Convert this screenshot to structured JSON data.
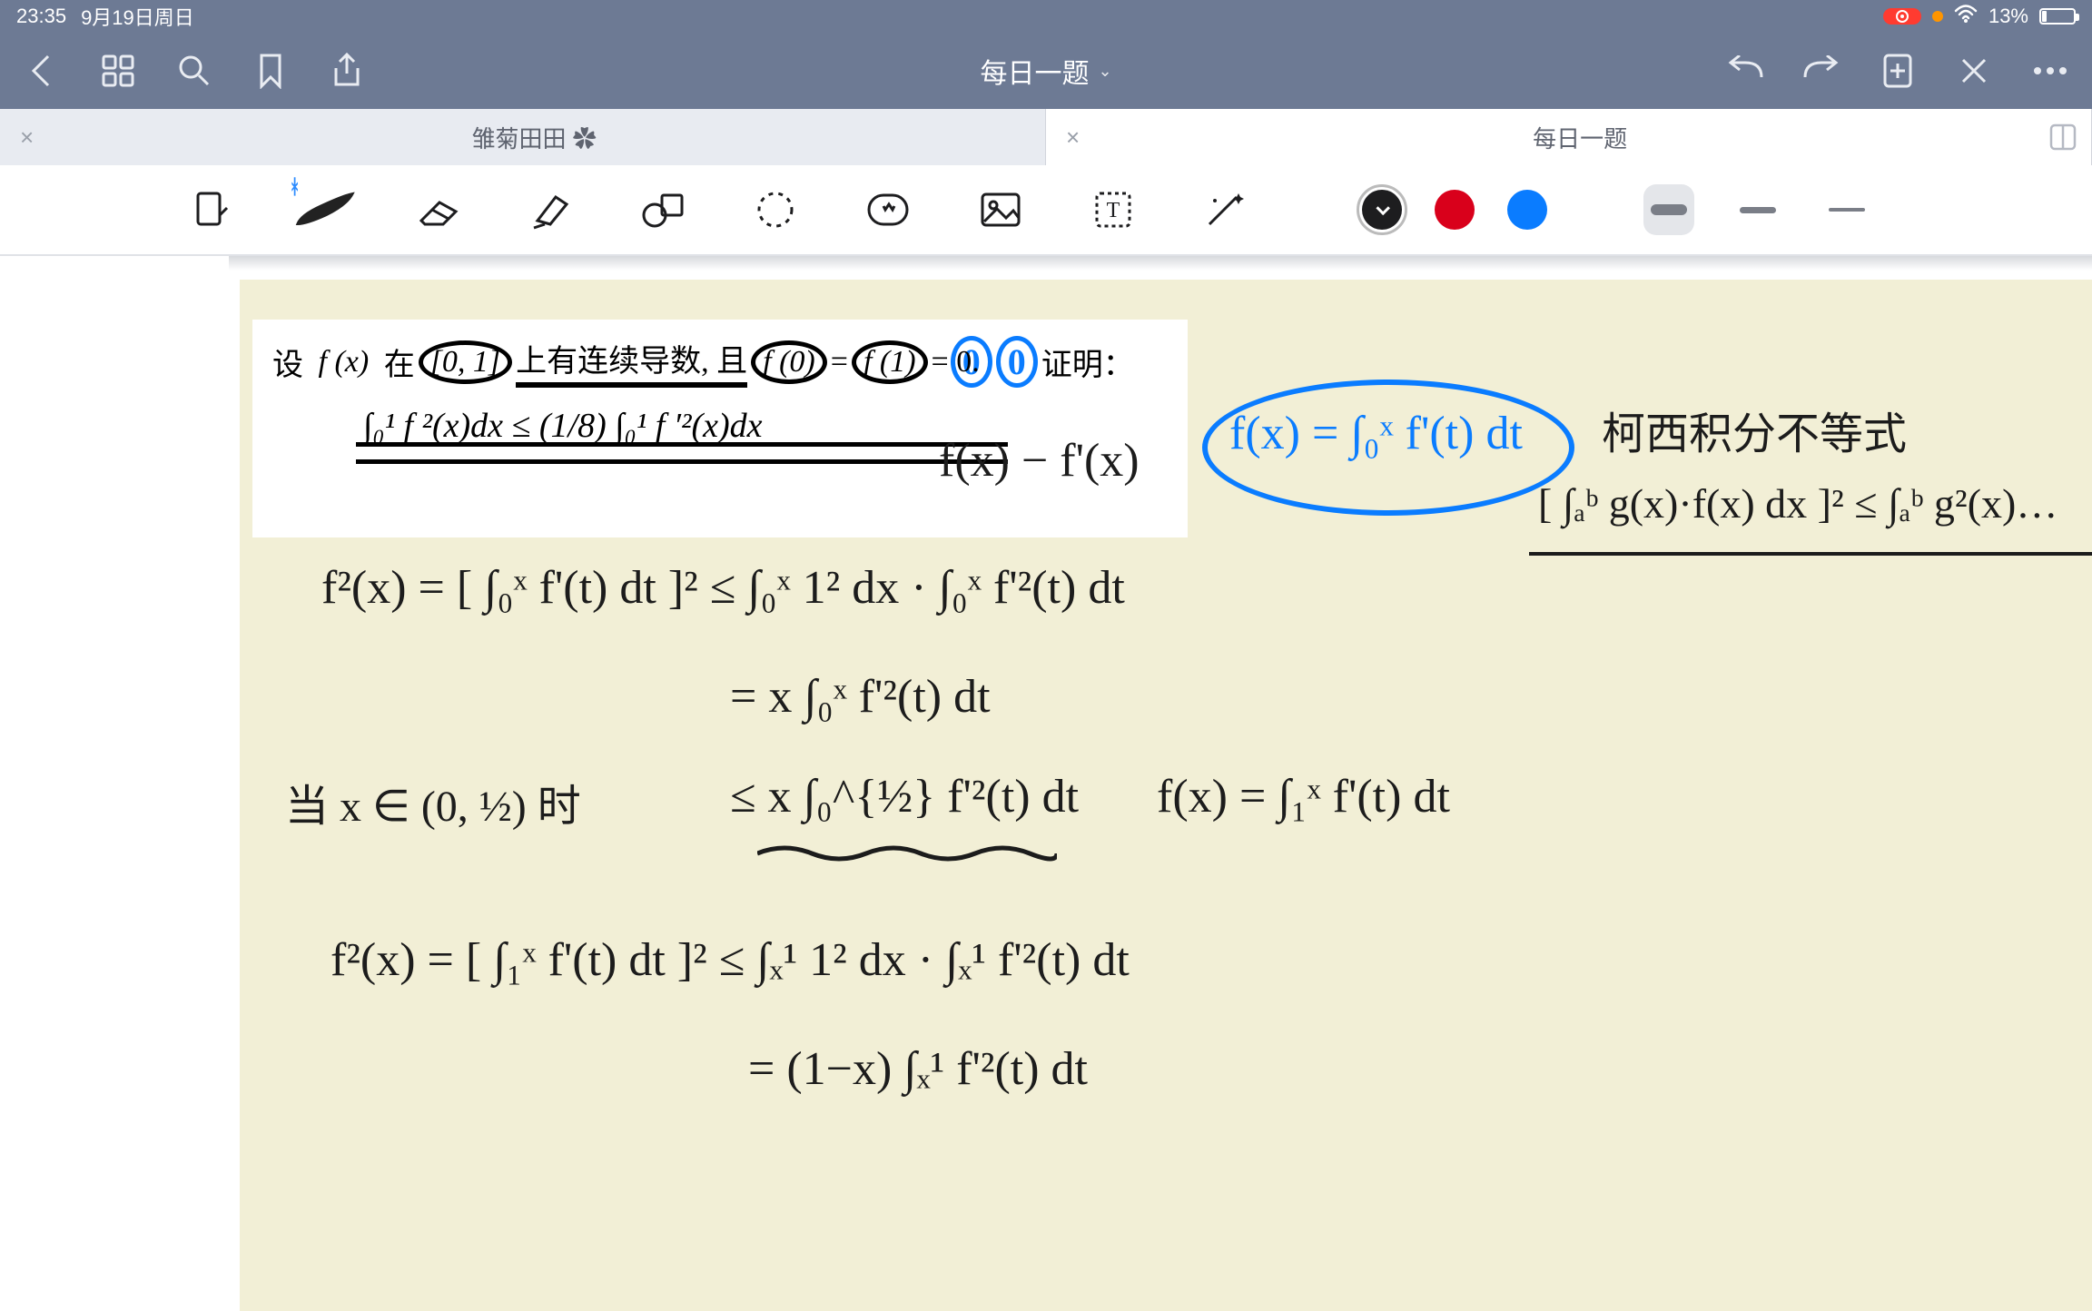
{
  "status": {
    "time": "23:35",
    "date": "9月19日周日",
    "battery_pct": "13%"
  },
  "nav": {
    "doc_title": "每日一题"
  },
  "tabs": {
    "inactive_title": "雏菊田田 ✿",
    "active_title": "每日一题"
  },
  "problem": {
    "prefix": "设",
    "func": "f (x)",
    "on": "在",
    "interval": "[0, 1]",
    "middle": "上有连续导数, 且",
    "f0": "f (0)",
    "eq": "=",
    "f1": "f (1)",
    "eq0": "= 0.",
    "prove": "证明：",
    "integral": "∫₀¹ f ²(x)dx ≤ (1/8) ∫₀¹ f ′²(x)dx",
    "blue_a": "0",
    "blue_b": "0"
  },
  "handwriting": {
    "h_top_right1": "f(x) − f'(x)",
    "h_blue_box": "f(x) = ∫₀ˣ f'(t) dt",
    "h_cauchy_label": "柯西积分不等式",
    "h_cauchy_formula": "[ ∫ₐᵇ g(x)·f(x) dx ]² ≤ ∫ₐᵇ g²(x)…",
    "h_line1": "f²(x) = [ ∫₀ˣ f'(t) dt ]² ≤ ∫₀ˣ 1² dx · ∫₀ˣ f'²(t) dt",
    "h_line2": "= x ∫₀ˣ f'²(t) dt",
    "h_cond": "当 x ∈ (0, ½) 时",
    "h_line3": "≤ x ∫₀^{½} f'²(t) dt",
    "h_side": "f(x) = ∫₁ˣ f'(t) dt",
    "h_line4": "f²(x) = [ ∫₁ˣ f'(t) dt ]² ≤ ∫ₓ¹ 1² dx · ∫ₓ¹ f'²(t) dt",
    "h_line5": "= (1−x) ∫ₓ¹ f'²(t) dt"
  }
}
